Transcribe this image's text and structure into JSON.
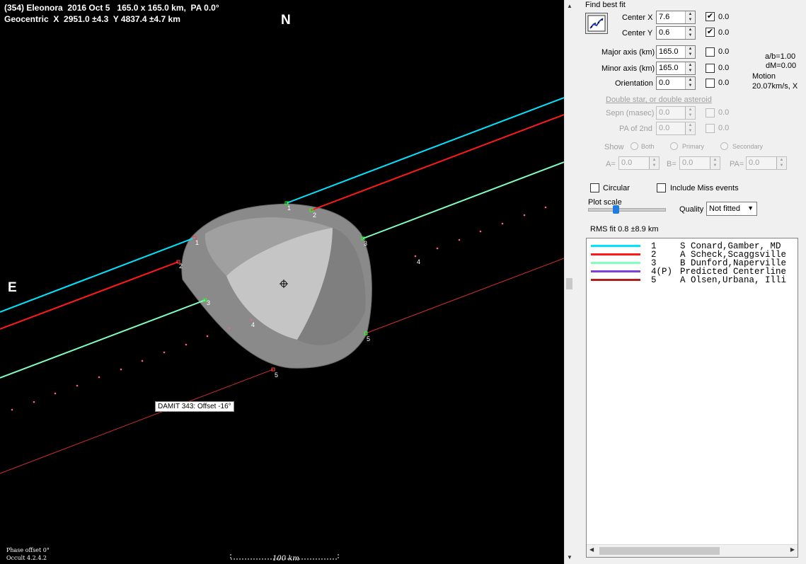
{
  "plot": {
    "title_line1": "(354) Eleonora  2016 Oct 5   165.0 x 165.0 km,  PA 0.0°",
    "title_line2": "Geocentric  X  2951.0 ±4.3  Y 4837.4 ±4.7 km",
    "north_label": "N",
    "east_label": "E",
    "shape_tooltip": "DAMIT 343: Offset -16°",
    "phase_offset": "Phase offset 0°",
    "version": "Occult 4.2.4.2",
    "scale_label": "100 km",
    "chord_numbers": [
      "1",
      "2",
      "3",
      "4",
      "5"
    ],
    "colors": {
      "background": "#000000",
      "chord1": "#00e5ff",
      "chord2": "#ff1a1a",
      "chord3": "#80ffc0",
      "predicted": "#ff6080",
      "chord5": "#d03030"
    }
  },
  "panel": {
    "find_best_fit": "Find best fit",
    "fit_icon": "chart-fit-icon",
    "center_x": {
      "label": "Center X",
      "value": "7.6",
      "check_label": "0.0",
      "checked": true
    },
    "center_y": {
      "label": "Center Y",
      "value": "0.6",
      "check_label": "0.0",
      "checked": true
    },
    "major_axis": {
      "label": "Major axis (km)",
      "value": "165.0",
      "check_label": "0.0",
      "checked": false
    },
    "minor_axis": {
      "label": "Minor axis (km)",
      "value": "165.0",
      "check_label": "0.0",
      "checked": false
    },
    "orientation": {
      "label": "Orientation",
      "value": "0.0",
      "check_label": "0.0",
      "checked": false
    },
    "ratio": "a/b=1.00",
    "dm": "dM=0.00",
    "motion_label": "Motion",
    "motion_value": "20.07km/s, X",
    "double_star": "Double star, or double asteroid",
    "sepn": {
      "label": "Sepn (masec)",
      "value": "0.0",
      "check_label": "0.0"
    },
    "pa2": {
      "label": "PA of 2nd",
      "value": "0.0",
      "check_label": "0.0"
    },
    "show_label": "Show",
    "show_both": "Both",
    "show_primary": "Primary",
    "show_secondary": "Secondary",
    "a_label": "A=",
    "a_value": "0.0",
    "b_label": "B=",
    "b_value": "0.0",
    "pa_label": "PA=",
    "pa_value": "0.0",
    "circular": "Circular",
    "include_miss": "Include Miss events",
    "plot_scale": "Plot scale",
    "quality_label": "Quality",
    "quality_value": "Not fitted",
    "rms_fit": "RMS fit 0.8 ±8.9 km"
  },
  "legend": [
    {
      "code": "1   ",
      "name": "S Conard,Gamber, MD",
      "color": "#00e5ff"
    },
    {
      "code": "2   ",
      "name": "A Scheck,Scaggsville",
      "color": "#ff1a1a"
    },
    {
      "code": "3   ",
      "name": "B Dunford,Naperville",
      "color": "#80ffc0"
    },
    {
      "code": "4(P)",
      "name": "Predicted Centerline",
      "color": "#8040e0"
    },
    {
      "code": "5   ",
      "name": "A Olsen,Urbana, Illi",
      "color": "#b02020"
    }
  ]
}
